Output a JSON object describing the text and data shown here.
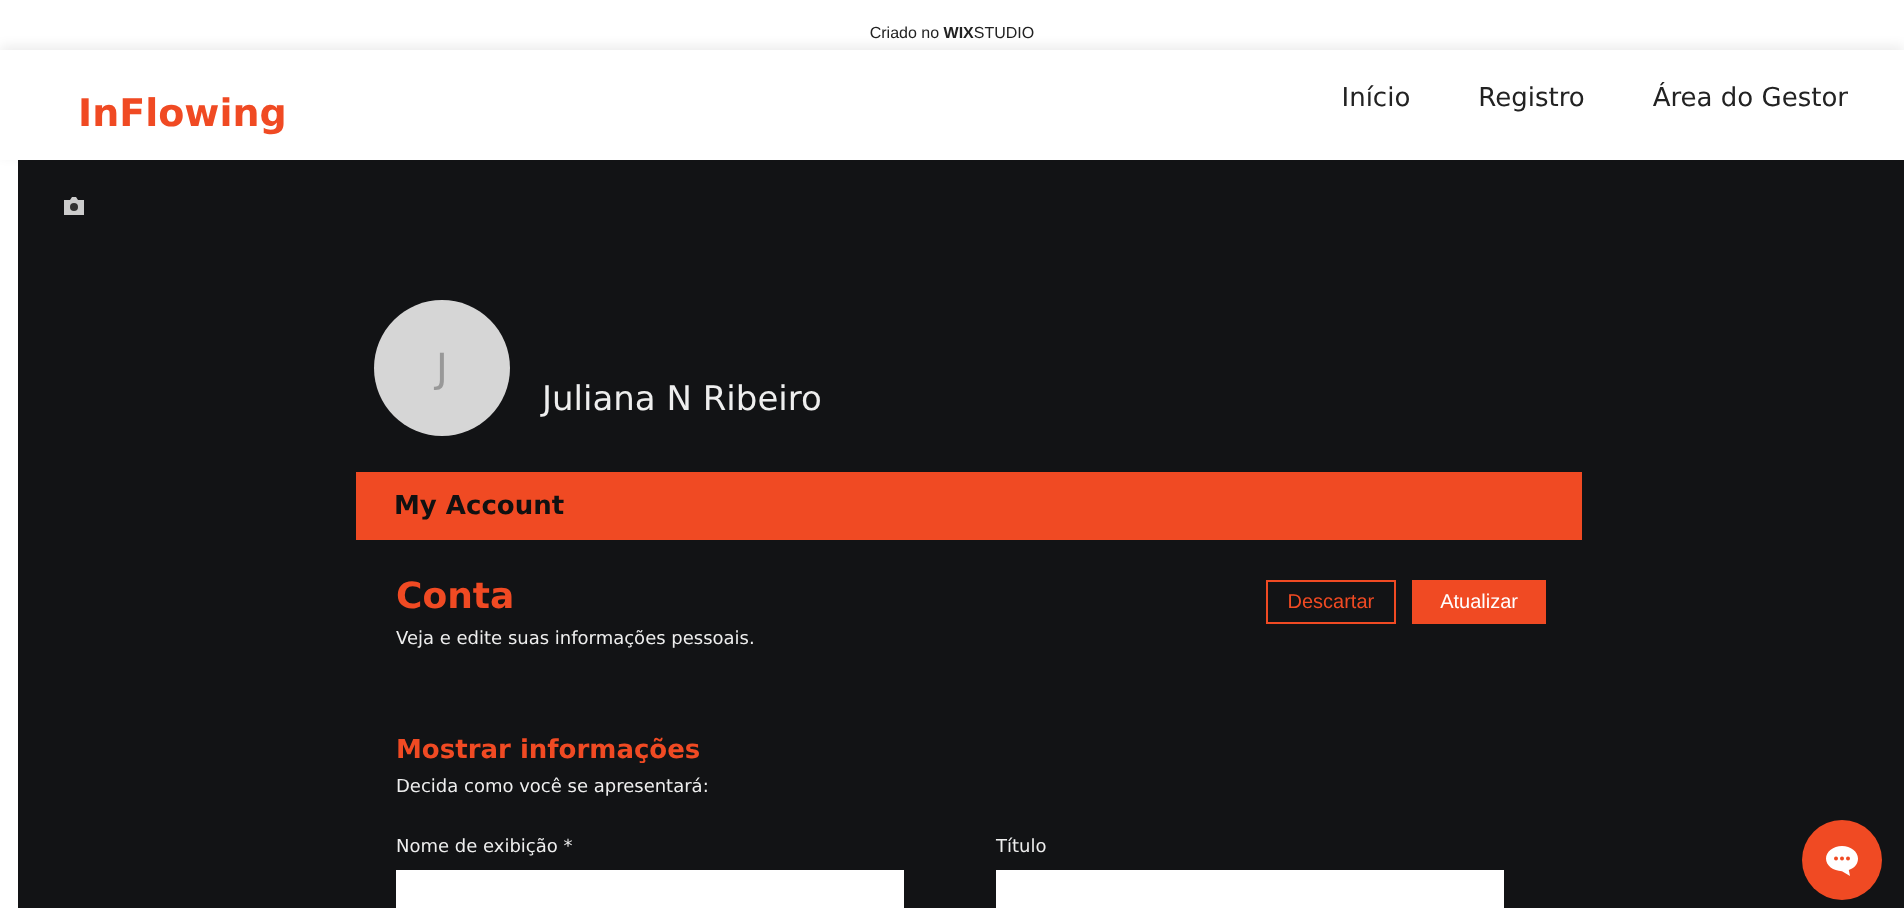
{
  "banner": {
    "prefix": "Criado no",
    "brand": "WIX",
    "product": "STUDIO"
  },
  "header": {
    "logo": "InFlowing",
    "nav": [
      {
        "label": "Início"
      },
      {
        "label": "Registro"
      },
      {
        "label": "Área do Gestor"
      }
    ]
  },
  "profile": {
    "initial": "J",
    "name": "Juliana N Ribeiro"
  },
  "account_bar": {
    "title": "My Account"
  },
  "section": {
    "title": "Conta",
    "subtitle": "Veja e edite suas informações pessoais.",
    "buttons": [
      {
        "label": "Descartar",
        "kind": "outline"
      },
      {
        "label": "Atualizar",
        "kind": "filled"
      }
    ]
  },
  "display": {
    "title": "Mostrar informações",
    "subtitle": "Decida como você se apresentará:",
    "fields": [
      {
        "label": "Nome de exibição *"
      },
      {
        "label": "Título"
      }
    ]
  }
}
